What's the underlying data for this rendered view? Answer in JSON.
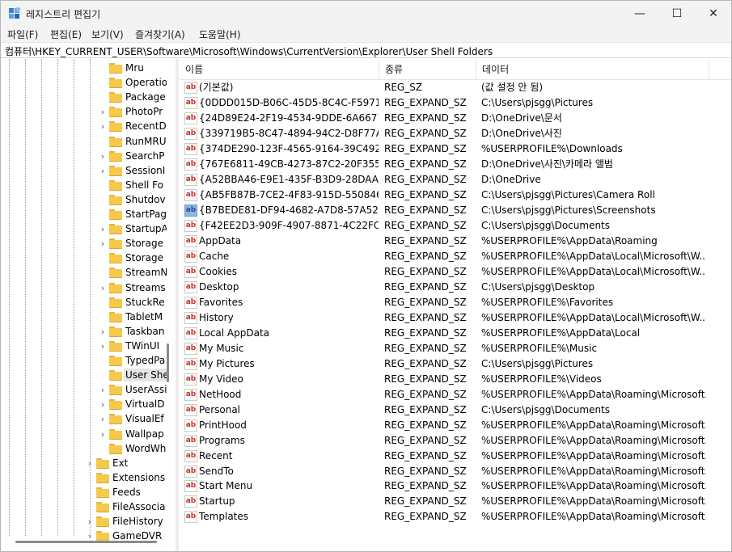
{
  "window": {
    "title": "레지스트리 편집기",
    "controls": {
      "minimize": "—",
      "maximize": "☐",
      "close": "✕"
    }
  },
  "menu": [
    "파일(F)",
    "편집(E)",
    "보기(V)",
    "즐겨찾기(A)",
    "도움말(H)"
  ],
  "address": "컴퓨터\\HKEY_CURRENT_USER\\Software\\Microsoft\\Windows\\CurrentVersion\\Explorer\\User Shell Folders",
  "tree": {
    "deep_items": [
      {
        "label": "Mru",
        "expandable": false
      },
      {
        "label": "Operatio",
        "expandable": false
      },
      {
        "label": "Package",
        "expandable": false
      },
      {
        "label": "PhotoPr",
        "expandable": true
      },
      {
        "label": "RecentD",
        "expandable": true
      },
      {
        "label": "RunMRU",
        "expandable": false
      },
      {
        "label": "SearchP",
        "expandable": true
      },
      {
        "label": "SessionI",
        "expandable": true
      },
      {
        "label": "Shell Fo",
        "expandable": false
      },
      {
        "label": "Shutdov",
        "expandable": false
      },
      {
        "label": "StartPag",
        "expandable": false
      },
      {
        "label": "StartupA",
        "expandable": true
      },
      {
        "label": "Storage",
        "expandable": true
      },
      {
        "label": "Storage",
        "expandable": false
      },
      {
        "label": "StreamN",
        "expandable": false
      },
      {
        "label": "Streams",
        "expandable": true
      },
      {
        "label": "StuckRe",
        "expandable": false
      },
      {
        "label": "TabletM",
        "expandable": false
      },
      {
        "label": "Taskban",
        "expandable": true
      },
      {
        "label": "TWinUI",
        "expandable": true
      },
      {
        "label": "TypedPa",
        "expandable": false
      },
      {
        "label": "User She",
        "expandable": false,
        "selected": true
      },
      {
        "label": "UserAssi",
        "expandable": true
      },
      {
        "label": "VirtualD",
        "expandable": true
      },
      {
        "label": "VisualEf",
        "expandable": true
      },
      {
        "label": "Wallpap",
        "expandable": true
      },
      {
        "label": "WordWh",
        "expandable": false
      }
    ],
    "shallow_items": [
      {
        "label": "Ext",
        "expandable": true
      },
      {
        "label": "Extensions",
        "expandable": false
      },
      {
        "label": "Feeds",
        "expandable": false
      },
      {
        "label": "FileAssocia",
        "expandable": false
      },
      {
        "label": "FileHistory",
        "expandable": true
      },
      {
        "label": "GameDVR",
        "expandable": true
      }
    ]
  },
  "columns": {
    "name": "이름",
    "type": "종류",
    "data": "데이터"
  },
  "rows": [
    {
      "name": "(기본값)",
      "type": "REG_SZ",
      "data": "(값 설정 안 됨)"
    },
    {
      "name": "{0DDD015D-B06C-45D5-8C4C-F5971...",
      "type": "REG_EXPAND_SZ",
      "data": "C:\\Users\\pjsgg\\Pictures"
    },
    {
      "name": "{24D89E24-2F19-4534-9DDE-6A6671...",
      "type": "REG_EXPAND_SZ",
      "data": "D:\\OneDrive\\문서"
    },
    {
      "name": "{339719B5-8C47-4894-94C2-D8F77A...",
      "type": "REG_EXPAND_SZ",
      "data": "D:\\OneDrive\\사진"
    },
    {
      "name": "{374DE290-123F-4565-9164-39C492...",
      "type": "REG_EXPAND_SZ",
      "data": "%USERPROFILE%\\Downloads"
    },
    {
      "name": "{767E6811-49CB-4273-87C2-20F355E...",
      "type": "REG_EXPAND_SZ",
      "data": "D:\\OneDrive\\사진\\카메라 앨범"
    },
    {
      "name": "{A52BBA46-E9E1-435F-B3D9-28DAA6...",
      "type": "REG_EXPAND_SZ",
      "data": "D:\\OneDrive"
    },
    {
      "name": "{AB5FB87B-7CE2-4F83-915D-550846...",
      "type": "REG_EXPAND_SZ",
      "data": "C:\\Users\\pjsgg\\Pictures\\Camera Roll"
    },
    {
      "name": "{B7BEDE81-DF94-4682-A7D8-57A526...",
      "type": "REG_EXPAND_SZ",
      "data": "C:\\Users\\pjsgg\\Pictures\\Screenshots",
      "highlight": true
    },
    {
      "name": "{F42EE2D3-909F-4907-8871-4C22FC0...",
      "type": "REG_EXPAND_SZ",
      "data": "C:\\Users\\pjsgg\\Documents"
    },
    {
      "name": "AppData",
      "type": "REG_EXPAND_SZ",
      "data": "%USERPROFILE%\\AppData\\Roaming"
    },
    {
      "name": "Cache",
      "type": "REG_EXPAND_SZ",
      "data": "%USERPROFILE%\\AppData\\Local\\Microsoft\\W..."
    },
    {
      "name": "Cookies",
      "type": "REG_EXPAND_SZ",
      "data": "%USERPROFILE%\\AppData\\Local\\Microsoft\\W..."
    },
    {
      "name": "Desktop",
      "type": "REG_EXPAND_SZ",
      "data": "C:\\Users\\pjsgg\\Desktop"
    },
    {
      "name": "Favorites",
      "type": "REG_EXPAND_SZ",
      "data": "%USERPROFILE%\\Favorites"
    },
    {
      "name": "History",
      "type": "REG_EXPAND_SZ",
      "data": "%USERPROFILE%\\AppData\\Local\\Microsoft\\W..."
    },
    {
      "name": "Local AppData",
      "type": "REG_EXPAND_SZ",
      "data": "%USERPROFILE%\\AppData\\Local"
    },
    {
      "name": "My Music",
      "type": "REG_EXPAND_SZ",
      "data": "%USERPROFILE%\\Music"
    },
    {
      "name": "My Pictures",
      "type": "REG_EXPAND_SZ",
      "data": "C:\\Users\\pjsgg\\Pictures"
    },
    {
      "name": "My Video",
      "type": "REG_EXPAND_SZ",
      "data": "%USERPROFILE%\\Videos"
    },
    {
      "name": "NetHood",
      "type": "REG_EXPAND_SZ",
      "data": "%USERPROFILE%\\AppData\\Roaming\\Microsoft..."
    },
    {
      "name": "Personal",
      "type": "REG_EXPAND_SZ",
      "data": "C:\\Users\\pjsgg\\Documents"
    },
    {
      "name": "PrintHood",
      "type": "REG_EXPAND_SZ",
      "data": "%USERPROFILE%\\AppData\\Roaming\\Microsoft..."
    },
    {
      "name": "Programs",
      "type": "REG_EXPAND_SZ",
      "data": "%USERPROFILE%\\AppData\\Roaming\\Microsoft..."
    },
    {
      "name": "Recent",
      "type": "REG_EXPAND_SZ",
      "data": "%USERPROFILE%\\AppData\\Roaming\\Microsoft..."
    },
    {
      "name": "SendTo",
      "type": "REG_EXPAND_SZ",
      "data": "%USERPROFILE%\\AppData\\Roaming\\Microsoft..."
    },
    {
      "name": "Start Menu",
      "type": "REG_EXPAND_SZ",
      "data": "%USERPROFILE%\\AppData\\Roaming\\Microsoft..."
    },
    {
      "name": "Startup",
      "type": "REG_EXPAND_SZ",
      "data": "%USERPROFILE%\\AppData\\Roaming\\Microsoft..."
    },
    {
      "name": "Templates",
      "type": "REG_EXPAND_SZ",
      "data": "%USERPROFILE%\\AppData\\Roaming\\Microsoft..."
    }
  ],
  "icons": {
    "app": "registry-editor-icon",
    "string_value": "ab",
    "folder": "folder-icon",
    "chevron": "›"
  },
  "colors": {
    "folder": "#f5c94c",
    "ab_text": "#c9312b",
    "highlight": "#8fb6e3",
    "selection": "#e5e5e5"
  }
}
